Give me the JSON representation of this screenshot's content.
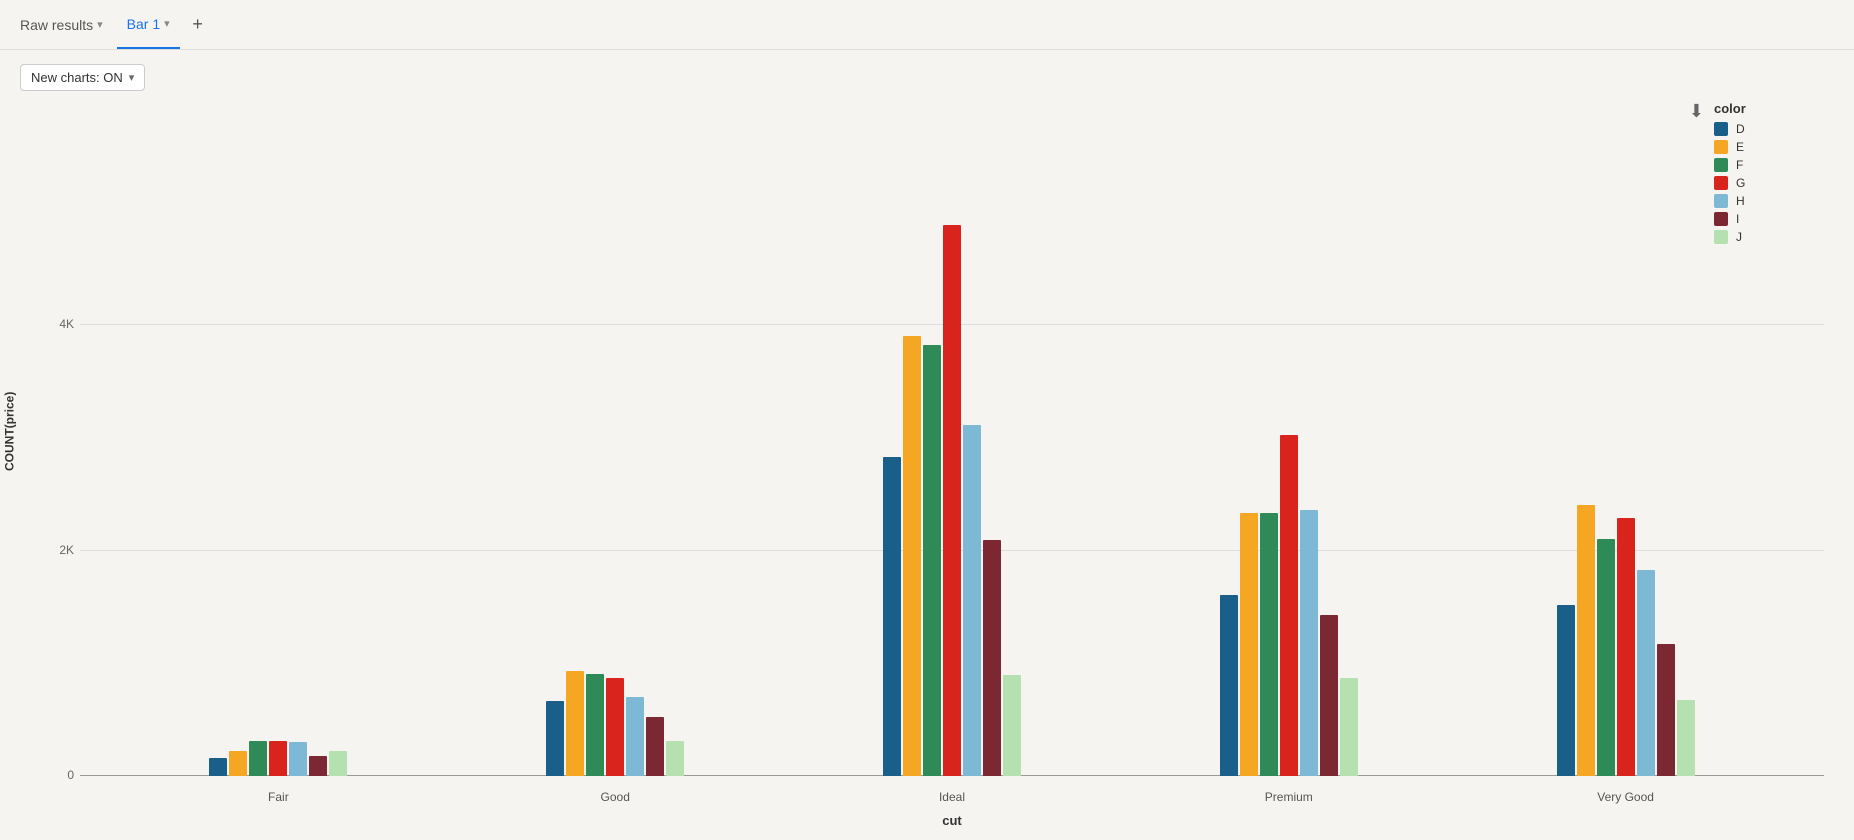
{
  "tabs": [
    {
      "id": "raw-results",
      "label": "Raw results",
      "active": false,
      "hasChevron": true
    },
    {
      "id": "bar1",
      "label": "Bar 1",
      "active": true,
      "hasChevron": true
    }
  ],
  "tab_add_label": "+",
  "toolbar": {
    "new_charts_label": "New charts: ON"
  },
  "chart": {
    "y_axis_label": "COUNT(price)",
    "x_axis_label": "cut",
    "y_ticks": [
      {
        "label": "0",
        "pct": 0
      },
      {
        "label": "2K",
        "pct": 37
      },
      {
        "label": "4K",
        "pct": 74
      }
    ],
    "groups": [
      {
        "label": "Fair",
        "bars": [
          {
            "color": "#1a5e8a",
            "value": 163,
            "max": 5500
          },
          {
            "color": "#f5a623",
            "value": 224,
            "max": 5500
          },
          {
            "color": "#2e8b57",
            "value": 312,
            "max": 5500
          },
          {
            "color": "#d9241e",
            "value": 312,
            "max": 5500
          },
          {
            "color": "#7db8d4",
            "value": 303,
            "max": 5500
          },
          {
            "color": "#7b2832",
            "value": 175,
            "max": 5500
          },
          {
            "color": "#b5e0b0",
            "value": 220,
            "max": 5500
          }
        ]
      },
      {
        "label": "Good",
        "bars": [
          {
            "color": "#1a5e8a",
            "value": 662,
            "max": 5500
          },
          {
            "color": "#f5a623",
            "value": 933,
            "max": 5500
          },
          {
            "color": "#2e8b57",
            "value": 909,
            "max": 5500
          },
          {
            "color": "#d9241e",
            "value": 871,
            "max": 5500
          },
          {
            "color": "#7db8d4",
            "value": 702,
            "max": 5500
          },
          {
            "color": "#7b2832",
            "value": 522,
            "max": 5500
          },
          {
            "color": "#b5e0b0",
            "value": 307,
            "max": 5500
          }
        ]
      },
      {
        "label": "Ideal",
        "bars": [
          {
            "color": "#1a5e8a",
            "value": 2834,
            "max": 5500
          },
          {
            "color": "#f5a623",
            "value": 3903,
            "max": 5500
          },
          {
            "color": "#2e8b57",
            "value": 3826,
            "max": 5500
          },
          {
            "color": "#d9241e",
            "value": 4884,
            "max": 5500
          },
          {
            "color": "#7db8d4",
            "value": 3115,
            "max": 5500
          },
          {
            "color": "#7b2832",
            "value": 2093,
            "max": 5500
          },
          {
            "color": "#b5e0b0",
            "value": 896,
            "max": 5500
          }
        ]
      },
      {
        "label": "Premium",
        "bars": [
          {
            "color": "#1a5e8a",
            "value": 1603,
            "max": 5500
          },
          {
            "color": "#f5a623",
            "value": 2337,
            "max": 5500
          },
          {
            "color": "#2e8b57",
            "value": 2331,
            "max": 5500
          },
          {
            "color": "#d9241e",
            "value": 3029,
            "max": 5500
          },
          {
            "color": "#7db8d4",
            "value": 2360,
            "max": 5500
          },
          {
            "color": "#7b2832",
            "value": 1428,
            "max": 5500
          },
          {
            "color": "#b5e0b0",
            "value": 870,
            "max": 5500
          }
        ]
      },
      {
        "label": "Very Good",
        "bars": [
          {
            "color": "#1a5e8a",
            "value": 1513,
            "max": 5500
          },
          {
            "color": "#f5a623",
            "value": 2400,
            "max": 5500
          },
          {
            "color": "#2e8b57",
            "value": 2104,
            "max": 5500
          },
          {
            "color": "#d9241e",
            "value": 2290,
            "max": 5500
          },
          {
            "color": "#7db8d4",
            "value": 1824,
            "max": 5500
          },
          {
            "color": "#7b2832",
            "value": 1169,
            "max": 5500
          },
          {
            "color": "#b5e0b0",
            "value": 678,
            "max": 5500
          }
        ]
      }
    ],
    "max_value": 5500
  },
  "legend": {
    "title": "color",
    "items": [
      {
        "label": "D",
        "color": "#1a5e8a"
      },
      {
        "label": "E",
        "color": "#f5a623"
      },
      {
        "label": "F",
        "color": "#2e8b57"
      },
      {
        "label": "G",
        "color": "#d9241e"
      },
      {
        "label": "H",
        "color": "#7db8d4"
      },
      {
        "label": "I",
        "color": "#7b2832"
      },
      {
        "label": "J",
        "color": "#b5e0b0"
      }
    ]
  }
}
